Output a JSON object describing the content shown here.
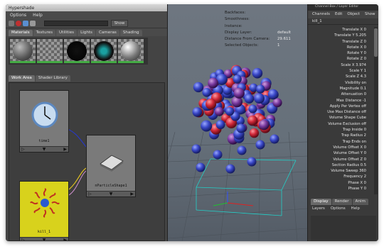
{
  "hypershade": {
    "title": "Hypershade",
    "menu": [
      "Options",
      "Help"
    ],
    "show_label": "Show",
    "material_tabs": [
      "Materials",
      "Textures",
      "Utilities",
      "Lights",
      "Cameras",
      "Shading"
    ],
    "work_tabs": [
      "Work Area",
      "Shader Library"
    ],
    "nodes": {
      "time": "time1",
      "shape": "nParticleShape1",
      "kill": "kill_1"
    }
  },
  "hud": [
    {
      "k": "Backfaces:",
      "v": ""
    },
    {
      "k": "Smoothness:",
      "v": ""
    },
    {
      "k": "Instance:",
      "v": ""
    },
    {
      "k": "Display Layer:",
      "v": "default"
    },
    {
      "k": "Distance From Camera:",
      "v": "29.611"
    },
    {
      "k": "Selected Objects:",
      "v": "1"
    }
  ],
  "channel_box": {
    "title": "Channel Box / Layer Editor",
    "menu": [
      "Channels",
      "Edit",
      "Object",
      "Show"
    ],
    "object": "kill_1",
    "attributes": [
      "Translate X 0",
      "Translate Y 5.205",
      "Translate Z 0",
      "Rotate X 0",
      "Rotate Y 0",
      "Rotate Z 0",
      "Scale X 3.974",
      "Scale Y 1",
      "Scale Z 4.3",
      "Visibility on",
      "Magnitude 0.1",
      "Attenuation 0",
      "Max Distance -1",
      "Apply Per Vertex off",
      "Use Max Distance off",
      "Volume Shape Cube",
      "Volume Exclusion off",
      "Trap Inside 0",
      "Trap Radius 2",
      "Trap Ends on",
      "Volume Offset X 0",
      "Volume Offset Y 0",
      "Volume Offset Z 0",
      "Section Radius 0.5",
      "Volume Sweep 360",
      "Frequency 2",
      "Phase X 0",
      "Phase Y 0"
    ],
    "bottom_tabs": [
      "Display",
      "Render",
      "Anim"
    ],
    "layers_menu": [
      "Layers",
      "Options",
      "Help"
    ]
  },
  "colors": {
    "accent": "#5a8fd0",
    "node_kill": "#d8d21c",
    "particle_blue": "#3a48c8",
    "particle_red": "#d02838"
  }
}
